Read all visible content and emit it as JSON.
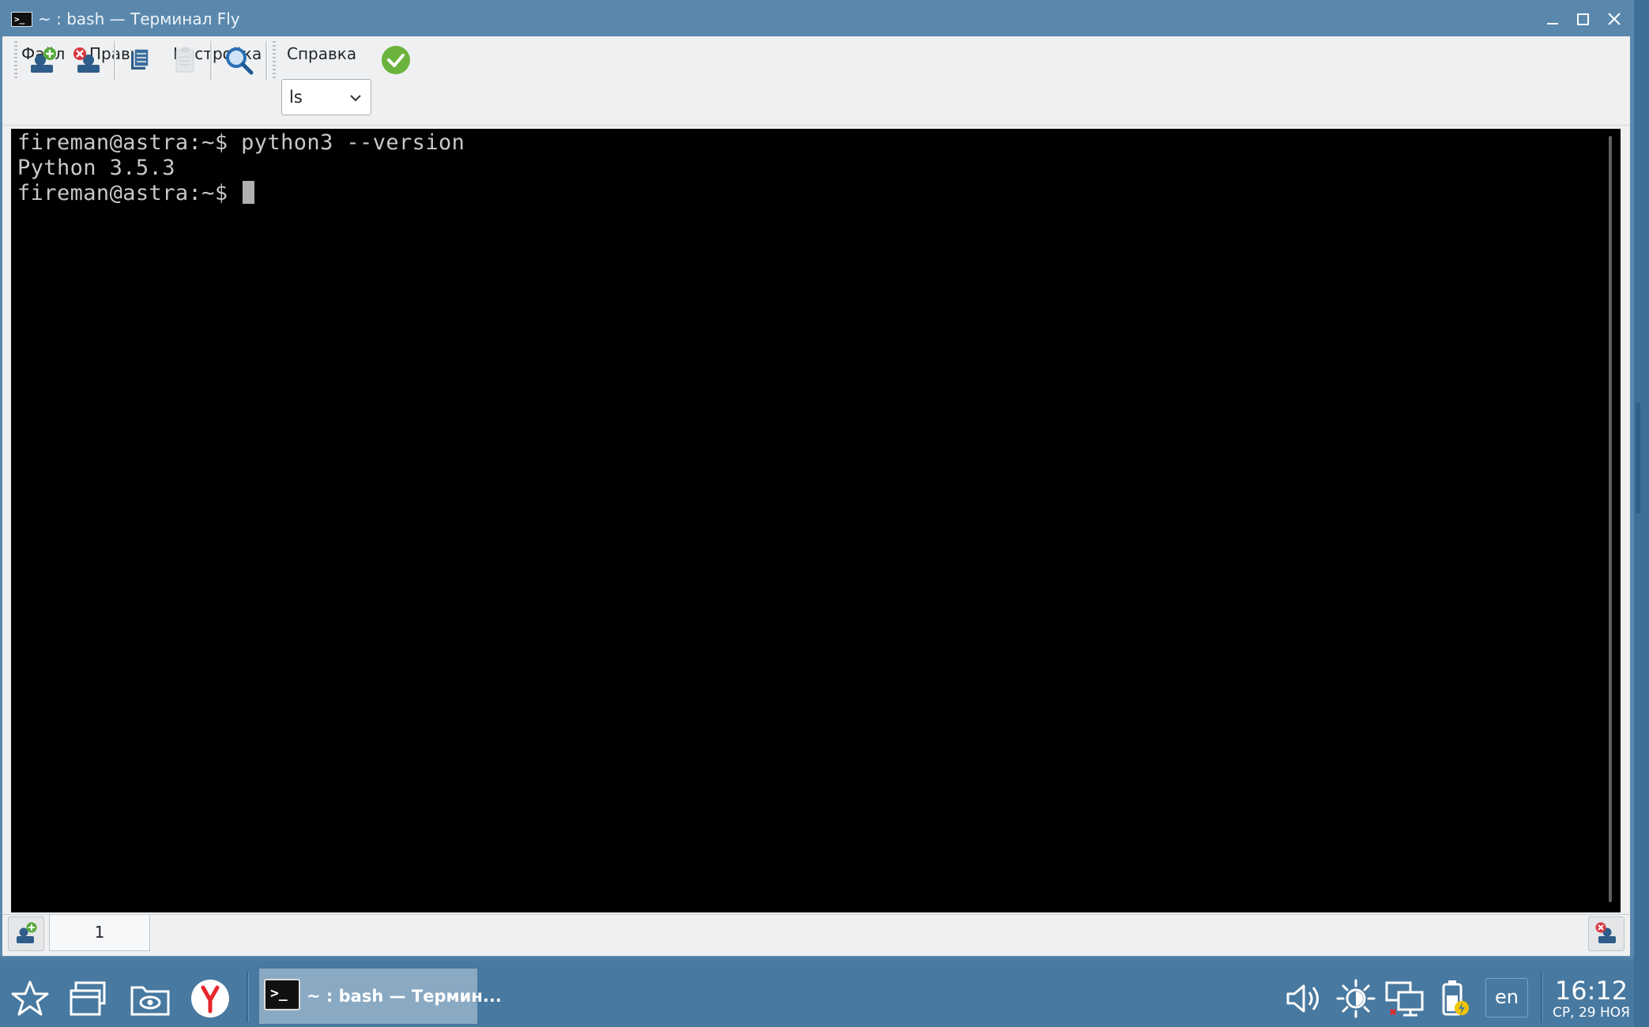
{
  "window": {
    "title": "~ : bash — Терминал Fly",
    "icon": "terminal-icon",
    "controls": [
      "minimize-icon",
      "maximize-icon",
      "close-icon"
    ]
  },
  "menu": [
    "Файл",
    "Правка",
    "Настройка",
    "Справка"
  ],
  "toolbar": {
    "buttons": [
      "new-tab-icon",
      "close-tab-icon",
      "copy-icon",
      "paste-icon",
      "search-icon"
    ],
    "command_value": "ls",
    "run_icon": "checkmark-icon"
  },
  "terminal": {
    "lines": [
      "fireman@astra:~$ python3 --version",
      "Python 3.5.3",
      "fireman@astra:~$ "
    ]
  },
  "tabs": {
    "items": [
      "1"
    ]
  },
  "taskbar": {
    "task_title": "~ : bash — Термин...",
    "lang": "en",
    "time": "16:12",
    "date": "СР, 29 НОЯ",
    "icons": [
      "start-menu-icon",
      "windows-icon",
      "file-manager-icon",
      "yandex-browser-icon",
      "volume-icon",
      "brightness-icon",
      "network-icon",
      "battery-icon"
    ]
  },
  "colors": {
    "desktop": "#4d7fa6",
    "terminal_bg": "#000000",
    "terminal_fg": "#c8c8c8",
    "accent_green": "#6bb33c"
  }
}
